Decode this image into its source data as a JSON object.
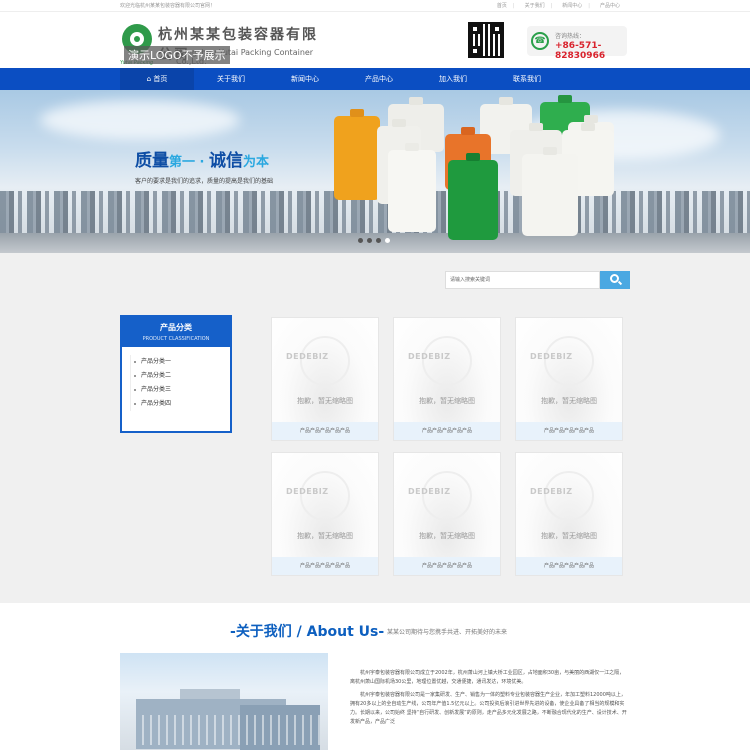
{
  "topbar": {
    "welcome": "欢迎光临杭州某某包装容器有限公司官网！",
    "links": [
      "首页",
      "关于我们",
      "新闻中心",
      "产品中心"
    ]
  },
  "header": {
    "logo_cn": "杭州某某包装容器有限公司",
    "logo_en": "Hangzhou Yutai Packing Container Co.,Ltd.",
    "logo_sub": "Yutai Packing",
    "logo_demo": "演示LOGO不予展示",
    "hotline_label": "咨询热线：",
    "hotline_number": "+86-571-82830966"
  },
  "nav": {
    "items": [
      "首页",
      "关于我们",
      "新闻中心",
      "产品中心",
      "加入我们",
      "联系我们"
    ]
  },
  "banner": {
    "title_a": "质量",
    "title_b": "第一",
    "title_sep": " · ",
    "title_c": "诚信",
    "title_d": "为本",
    "subtitle": "客户的要求是我们的追求，质量的提高是我们的基础",
    "active_slide": 2,
    "slide_count": 4
  },
  "search": {
    "placeholder": "请输入搜索关键词"
  },
  "sidebar": {
    "title_cn": "产品分类",
    "title_en": "PRODUCT CLASSIFICATION",
    "items": [
      "产品分类一",
      "产品分类二",
      "产品分类三",
      "产品分类四"
    ]
  },
  "products": {
    "placeholder_logo": "DEDEBIZ",
    "placeholder_text": "抱歉，暂无缩略图",
    "items": [
      {
        "name": "产品产品产品产品产品"
      },
      {
        "name": "产品产品产品产品产品"
      },
      {
        "name": "产品产品产品产品产品"
      },
      {
        "name": "产品产品产品产品产品"
      },
      {
        "name": "产品产品产品产品产品"
      },
      {
        "name": "产品产品产品产品产品"
      }
    ]
  },
  "about": {
    "title_dash_l": "-",
    "title": "关于我们 / About Us",
    "title_dash_r": "-",
    "slogan": "某某公司期待与您携手共进、开拓美好的未来",
    "paragraphs": [
      "杭州宇泰包装容器有限公司成立于2002年，杭州萧山河上镇大桥工业园区，占地面积30亩，与美丽的西湖仅一江之隔，离杭州萧山国际机场30公里，地理位置优越，交通便捷，通讯发达，环境优美。",
      "杭州宇泰包装容器有限公司是一家集研发、生产、销售为一体的塑料专业包装容器生产企业，年加工塑料12000吨以上，拥有20多以上的全自动生产线，公司年产值1.5亿元以上。公司投资后浪引进世界先进的设备，使企业具备了相当的规模和实力。长期以来，公司始终 坚持“自行研发、创新发展”的原则，走产品多元化发展之路，不断融合现代化的生产、设计技术、开发新产品，产品广泛"
    ]
  },
  "colors": {
    "brand_blue": "#0b4ec2",
    "accent_green": "#2f9a4a",
    "hotline_red": "#d9232d",
    "search_btn": "#4aa8e2"
  }
}
